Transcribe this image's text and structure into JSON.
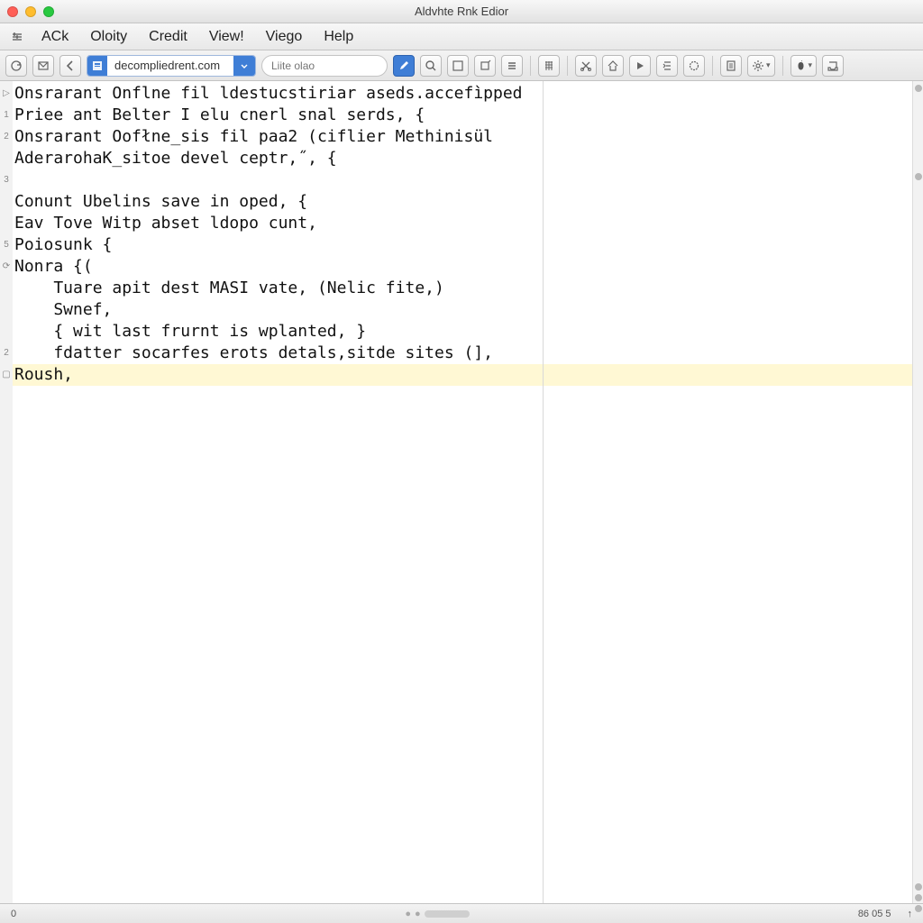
{
  "window": {
    "title": "Aldvhte Rnk Edior"
  },
  "menubar": {
    "items": [
      "ACk",
      "Oloity",
      "Credit",
      "View!",
      "Viego",
      "Help"
    ]
  },
  "toolbar": {
    "url": "decompliedrent.com",
    "search_placeholder": "Liite olao"
  },
  "gutter": {
    "icons": [
      "▷",
      "1",
      "2",
      " ",
      "3",
      " ",
      "",
      "5",
      "⟳",
      "",
      "",
      "",
      "2",
      "▢",
      ""
    ]
  },
  "code": {
    "lines": [
      "Onsrarant Onflne fil ldestucstiriar aseds.accefìpped",
      "Priee ant Belter I elu cnerl snal serds, {",
      "Onsrarant Oofłne_sis fil paa2 (ciflier Methinisül",
      "AderarohaK_sitoe devel ceptr,˝, {",
      "",
      "Conunt Ubelins save in oped, {",
      "Eav Tove Witp abset ldopo cunt,",
      "Poiosunk {",
      "Nonra {(",
      "    Tuare apit dest MASI vate, (Nelic fite,)",
      "    Swnef,",
      "    { wit last frurnt is wplanted, }",
      "    fdatter socarfes erots detals,sitde sites (],",
      "Roush,"
    ],
    "highlight_index": 13
  },
  "statusbar": {
    "left": "0",
    "pos": "86 05 5",
    "upload_icon": "↑"
  },
  "colors": {
    "highlight": "#fff8d4",
    "accent": "#3f7ed6"
  }
}
